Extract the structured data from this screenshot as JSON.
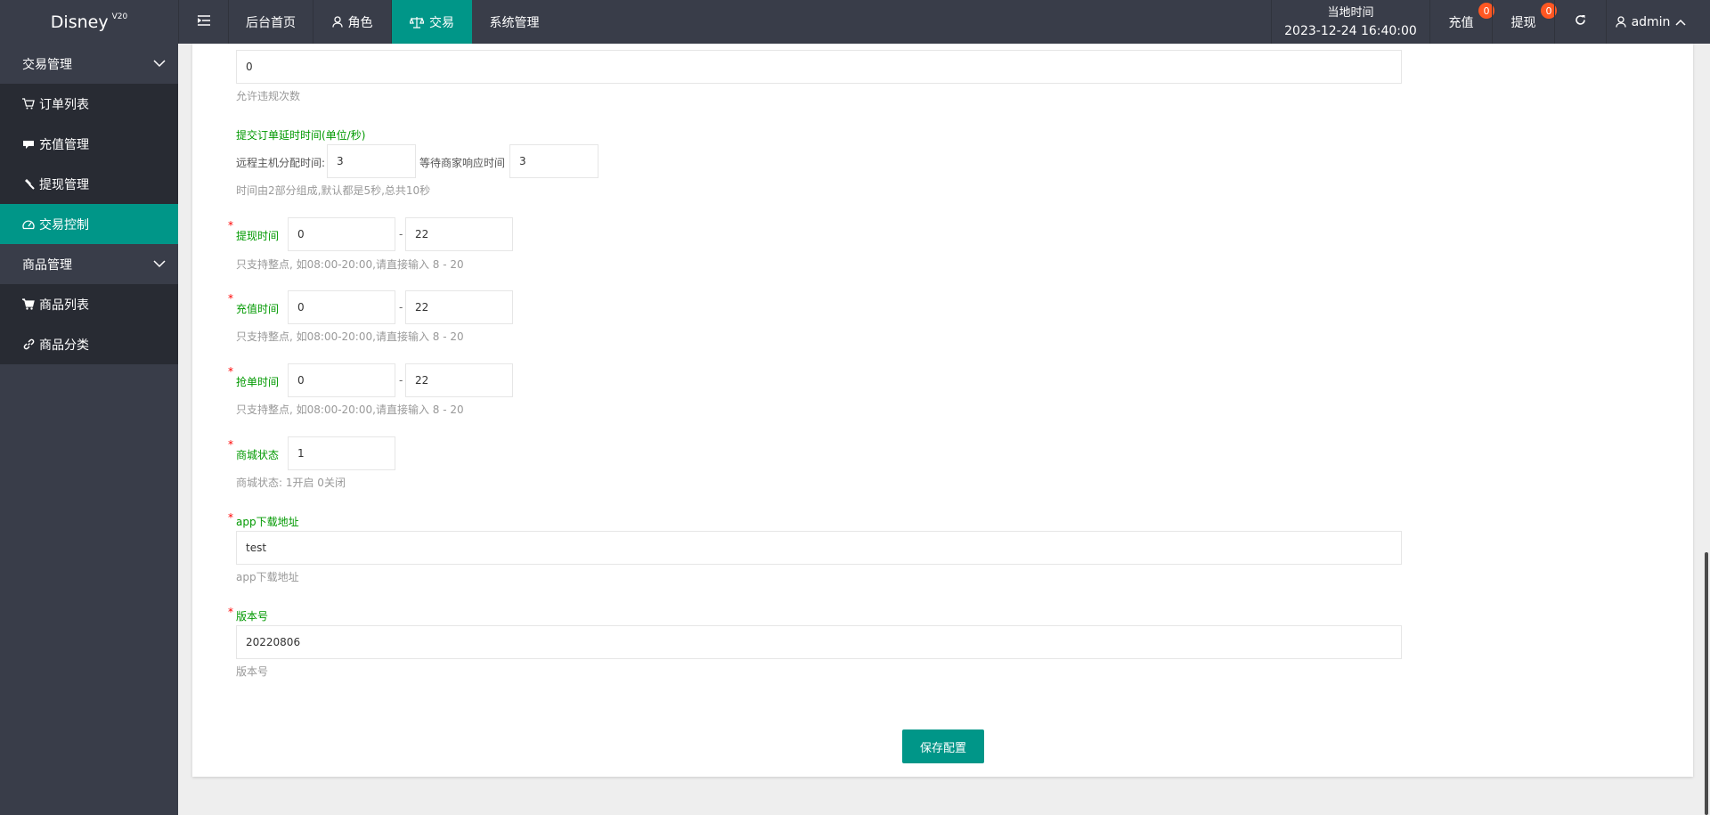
{
  "app": {
    "name": "Disney",
    "version": "V20"
  },
  "header": {
    "nav": [
      {
        "label": "后台首页"
      },
      {
        "label": "角色"
      },
      {
        "label": "交易"
      },
      {
        "label": "系统管理"
      }
    ],
    "clock_label": "当地时间",
    "clock_value": "2023-12-24 16:40:00",
    "recharge": {
      "label": "充值",
      "badge": "0"
    },
    "withdraw": {
      "label": "提现",
      "badge": "0"
    },
    "user": "admin"
  },
  "sidebar": {
    "groups": [
      {
        "label": "交易管理",
        "items": [
          {
            "label": "订单列表",
            "icon": "cart-icon"
          },
          {
            "label": "充值管理",
            "icon": "card-icon"
          },
          {
            "label": "提现管理",
            "icon": "hammer-icon"
          },
          {
            "label": "交易控制",
            "icon": "dashboard-icon"
          }
        ]
      },
      {
        "label": "商品管理",
        "items": [
          {
            "label": "商品列表",
            "icon": "cart-icon"
          },
          {
            "label": "商品分类",
            "icon": "link-icon"
          }
        ]
      }
    ]
  },
  "form": {
    "violations": {
      "value": "0",
      "help": "允许违规次数"
    },
    "delay": {
      "title": "提交订单延时时间(单位/秒)",
      "remote_label": "远程主机分配时间:",
      "remote_value": "3",
      "wait_label": "等待商家响应时间",
      "wait_value": "3",
      "help": "时间由2部分组成,默认都是5秒,总共10秒"
    },
    "withdraw_time": {
      "label": "提现时间",
      "from": "0",
      "to": "22",
      "sep": "-",
      "help": "只支持整点, 如08:00-20:00,请直接输入 8 - 20"
    },
    "recharge_time": {
      "label": "充值时间",
      "from": "0",
      "to": "22",
      "sep": "-",
      "help": "只支持整点, 如08:00-20:00,请直接输入 8 - 20"
    },
    "grab_time": {
      "label": "抢单时间",
      "from": "0",
      "to": "22",
      "sep": "-",
      "help": "只支持整点, 如08:00-20:00,请直接输入 8 - 20"
    },
    "mall_status": {
      "label": "商城状态",
      "value": "1",
      "help": "商城状态: 1开启 0关闭"
    },
    "app_url": {
      "label": "app下载地址",
      "value": "test",
      "help": "app下载地址"
    },
    "version": {
      "label": "版本号",
      "value": "20220806",
      "help": "版本号"
    },
    "required_mark": "*",
    "save_label": "保存配置"
  },
  "colors": {
    "header_bg": "#393d49",
    "accent": "#009688",
    "badge": "#ff5722",
    "label_green": "#009900",
    "required_red": "#ff0000"
  }
}
